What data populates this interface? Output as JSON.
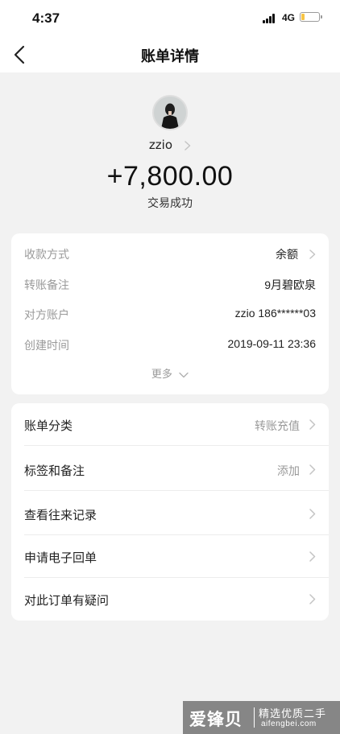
{
  "status_bar": {
    "time": "4:37",
    "network": "4G",
    "battery_level": 0.2,
    "battery_color": "#f6c445"
  },
  "nav": {
    "back_icon": "chevron-left-icon",
    "title": "账单详情"
  },
  "header": {
    "avatar_icon": "user-avatar-photo",
    "payee_name": "zzio",
    "amount": "+7,800.00",
    "status": "交易成功"
  },
  "details": {
    "rows": [
      {
        "label": "收款方式",
        "value": "余额",
        "has_chevron": true
      },
      {
        "label": "转账备注",
        "value": "9月碧欧泉",
        "has_chevron": false
      },
      {
        "label": "对方账户",
        "value": "zzio 186******03",
        "has_chevron": false
      },
      {
        "label": "创建时间",
        "value": "2019-09-11 23:36",
        "has_chevron": false
      }
    ],
    "more_label": "更多"
  },
  "actions": {
    "rows": [
      {
        "label": "账单分类",
        "value": "转账充值"
      },
      {
        "label": "标签和备注",
        "value": "添加"
      },
      {
        "label": "查看往来记录",
        "value": ""
      },
      {
        "label": "申请电子回单",
        "value": ""
      },
      {
        "label": "对此订单有疑问",
        "value": ""
      }
    ]
  },
  "watermark": {
    "brand": "爱锋贝",
    "tagline": "精选优质二手",
    "url": "aifengbei.com"
  },
  "colors": {
    "background": "#f2f2f2",
    "card": "#ffffff",
    "muted_text": "#9a9a9a"
  }
}
